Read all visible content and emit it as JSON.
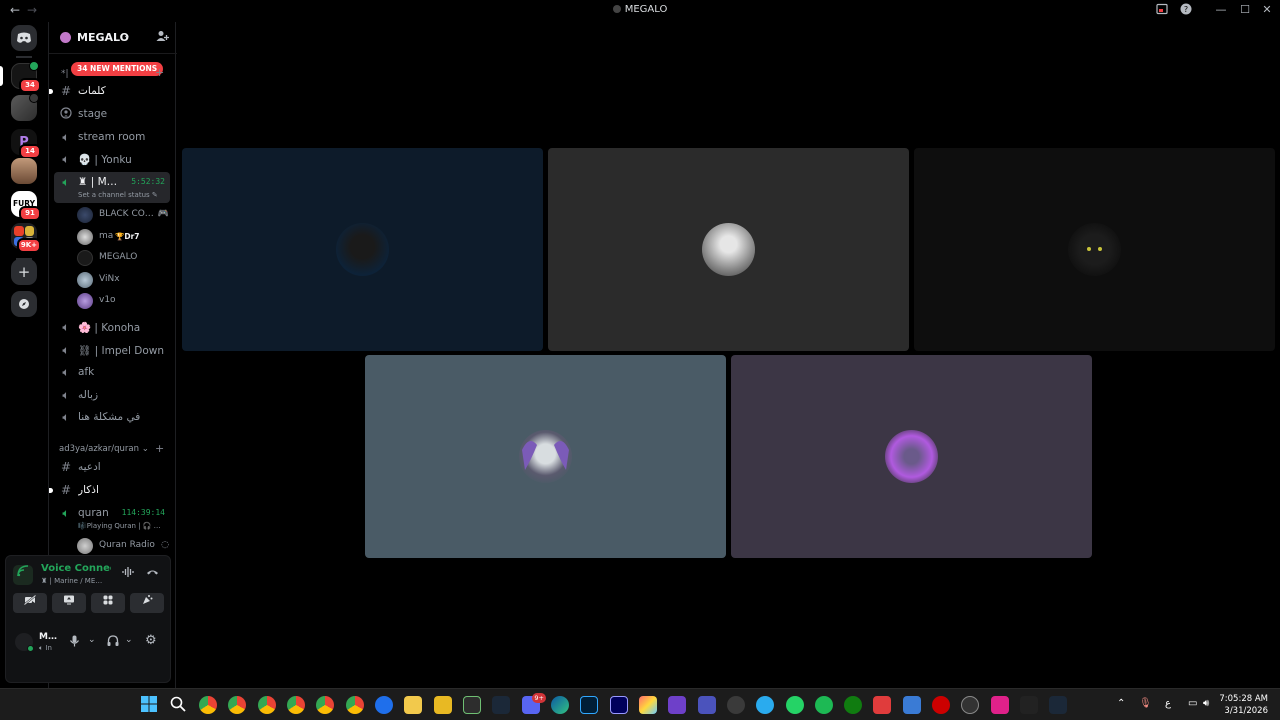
{
  "window": {
    "title": "MEGALO",
    "back_glyph": "←",
    "forward_glyph": "→",
    "controls": {
      "inbox_icon": "inbox-icon",
      "help_icon": "help-icon",
      "minimize": "—",
      "maximize": "☐",
      "close": "✕"
    }
  },
  "server_rail": {
    "servers": [
      {
        "name": "direct-messages",
        "badge": ""
      },
      {
        "name": "server-1",
        "badge": "34"
      },
      {
        "name": "server-2",
        "badge": ""
      },
      {
        "name": "server-3",
        "badge": "14"
      },
      {
        "name": "server-4",
        "badge": ""
      },
      {
        "name": "server-fury",
        "label": "FURY",
        "badge": "91"
      },
      {
        "name": "server-folder",
        "badge": "9K+"
      },
      {
        "name": "add-server",
        "glyph": "+"
      },
      {
        "name": "explore",
        "glyph": "◉"
      }
    ]
  },
  "guild": {
    "name": "MEGALO",
    "chevron": "⌄",
    "invite_glyph": "⊕"
  },
  "mentions_banner": "34 NEW MENTIONS",
  "channels": [
    {
      "name": "كلمات",
      "type": "text",
      "unread": true
    },
    {
      "name": "stage",
      "type": "stage"
    },
    {
      "name": "stream room",
      "type": "voice"
    },
    {
      "name": "💀 | Yonku",
      "type": "voice"
    },
    {
      "name": "♜ | M…",
      "type": "voice",
      "active": true,
      "timer": "5:52:32",
      "status": "Set a channel status ✎"
    }
  ],
  "voice_users": [
    {
      "name": "BLACK CO…",
      "trail": "🎮"
    },
    {
      "name": "ma",
      "tag": "🏆Dr7"
    },
    {
      "name": "MEGALO"
    },
    {
      "name": "ViNx"
    },
    {
      "name": "v1o"
    }
  ],
  "channels_after": [
    {
      "name": "🌸 | Konoha",
      "type": "voice"
    },
    {
      "name": "⛓ | Impel Down",
      "type": "voice"
    },
    {
      "name": "afk",
      "type": "voice"
    },
    {
      "name": "زباله",
      "type": "voice"
    },
    {
      "name": "في مشكلة هنا",
      "type": "voice"
    }
  ],
  "category2": {
    "name": "ad3ya/azkar/quran",
    "chevron": "⌄",
    "plus": "+"
  },
  "channels_cat2": [
    {
      "name": "ادعيه",
      "type": "text"
    },
    {
      "name": "اذكار",
      "type": "text",
      "unread": true
    },
    {
      "name": "quran",
      "type": "voice",
      "timer": "114:39:14",
      "status": "🎼Playing Quran | 🎧 …"
    }
  ],
  "quran_user": {
    "name": "Quran Radio"
  },
  "voice_panel": {
    "title": "Voice Connected",
    "subtitle": "♜ | Marine / ME…",
    "buttons": [
      "camera-off-icon",
      "screenshare-icon",
      "activities-icon",
      "soundboard-icon"
    ]
  },
  "user_panel": {
    "name": "M…",
    "status": "In"
  },
  "tiles": [
    {
      "name": "tile-1",
      "bg": "#0d1b2a"
    },
    {
      "name": "tile-2",
      "bg": "#2b2b2b"
    },
    {
      "name": "tile-3",
      "bg": "#0e0e0e"
    },
    {
      "name": "tile-4",
      "bg": "#4a5b66"
    },
    {
      "name": "tile-5",
      "bg": "#3c3645"
    }
  ],
  "taskbar": {
    "start_badge": "9+",
    "clock_time": "7:05:28 AM",
    "clock_date": "3/31/2026",
    "lang": "ع"
  }
}
